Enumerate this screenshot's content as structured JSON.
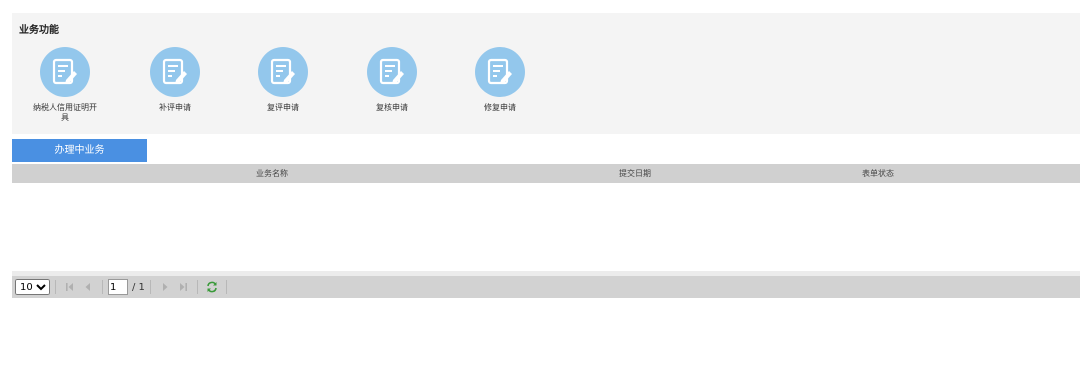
{
  "functions": {
    "title": "业务功能",
    "items": [
      {
        "label": "纳税人信用证明开具",
        "icon": "edit-document-icon"
      },
      {
        "label": "补评申请",
        "icon": "edit-document-icon"
      },
      {
        "label": "复评申请",
        "icon": "edit-document-icon"
      },
      {
        "label": "复核申请",
        "icon": "edit-document-icon"
      },
      {
        "label": "修复申请",
        "icon": "edit-document-icon"
      }
    ]
  },
  "tabs": {
    "active_label": "办理中业务"
  },
  "table": {
    "columns": [
      "业务名称",
      "提交日期",
      "表单状态"
    ],
    "rows": []
  },
  "pager": {
    "page_size": "10",
    "page_size_options": [
      "10"
    ],
    "current_page": "1",
    "total_pages": "/ 1"
  },
  "colors": {
    "icon_circle": "#93c7ec",
    "active_tab": "#4a90e2",
    "header_bg": "#d0d0d0",
    "panel_bg": "#f4f4f4"
  }
}
